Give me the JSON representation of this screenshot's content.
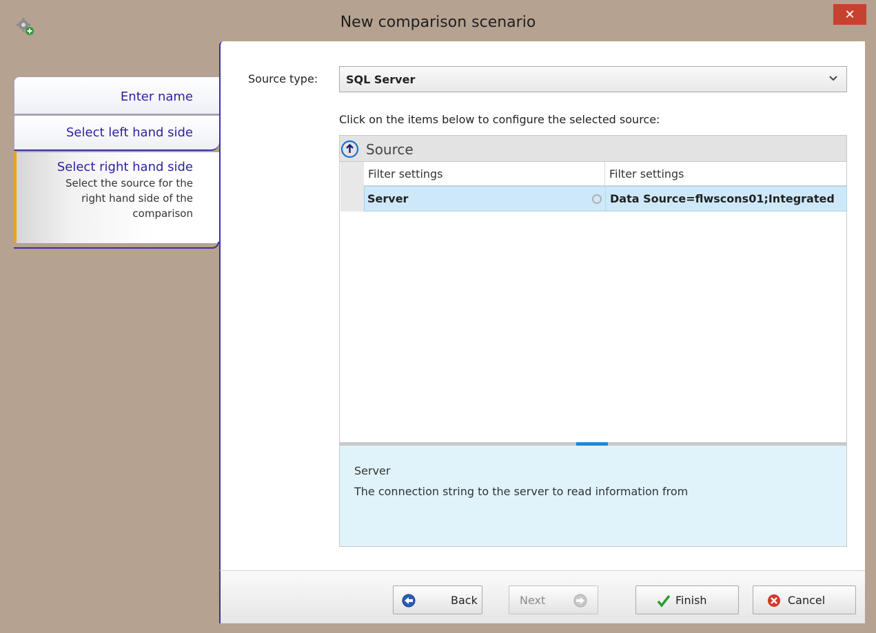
{
  "window": {
    "title": "New comparison scenario",
    "close_symbol": "✕"
  },
  "steps": {
    "enter_name": "Enter name",
    "left": "Select left hand side",
    "right": {
      "title": "Select right hand side",
      "desc_line1": "Select the source for the",
      "desc_line2": "right hand side of the",
      "desc_line3": "comparison"
    }
  },
  "form": {
    "source_type_label": "Source type:",
    "source_type_value": "SQL Server",
    "instructions": "Click on the items below to configure the selected source:"
  },
  "grid": {
    "group_title": "Source",
    "columns": [
      "Filter settings",
      "Filter settings"
    ],
    "rows": [
      {
        "name": "Server",
        "value": "Data Source=flwscons01;Integrated"
      }
    ]
  },
  "description": {
    "title": "Server",
    "text": "The connection string to the server to read information from"
  },
  "buttons": {
    "back": "Back",
    "next": "Next",
    "finish": "Finish",
    "cancel": "Cancel"
  },
  "colors": {
    "accent": "#3a2fa4",
    "highlight": "#cde9f9",
    "close": "#c7412f",
    "background": "#b5a290"
  }
}
